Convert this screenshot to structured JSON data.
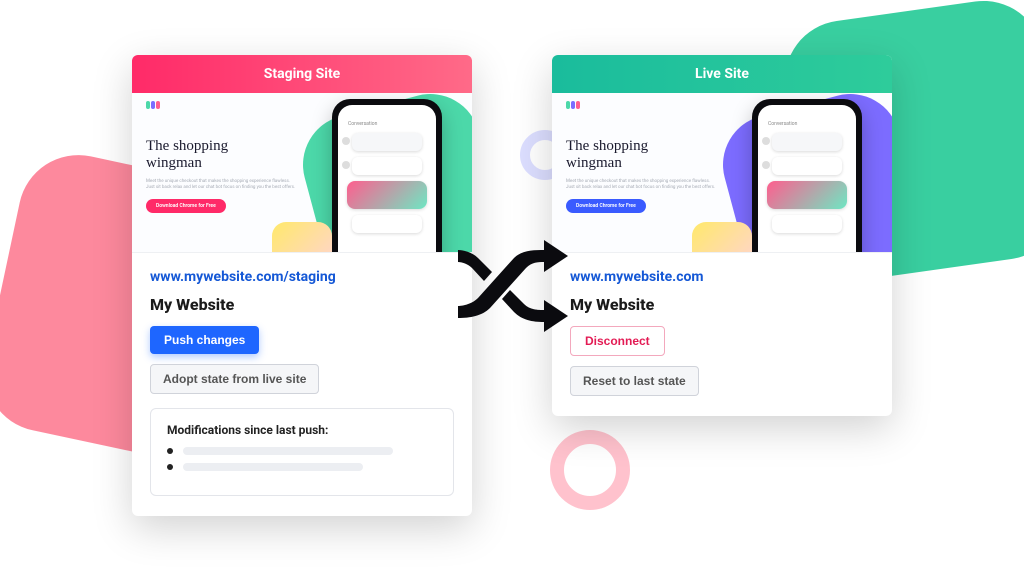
{
  "staging": {
    "header": "Staging Site",
    "preview": {
      "heading_line1": "The shopping",
      "heading_line2": "wingman",
      "cta": "Download Chrome for Free",
      "chat_title": "Conversation"
    },
    "url": "www.mywebsite.com/staging",
    "site_title": "My Website",
    "push_label": "Push changes",
    "adopt_label": "Adopt state from live site",
    "mods_title": "Modifications since last push:"
  },
  "live": {
    "header": "Live Site",
    "preview": {
      "heading_line1": "The shopping",
      "heading_line2": "wingman",
      "cta": "Download Chrome for Free",
      "chat_title": "Conversation"
    },
    "url": "www.mywebsite.com",
    "site_title": "My Website",
    "disconnect_label": "Disconnect",
    "reset_label": "Reset to last state"
  },
  "colors": {
    "staging_header_from": "#ff2a68",
    "staging_header_to": "#ff6a88",
    "live_header_from": "#1abc9c",
    "live_header_to": "#2ecc9b",
    "primary": "#1e66ff",
    "link": "#1558d6",
    "danger": "#e31b54"
  }
}
